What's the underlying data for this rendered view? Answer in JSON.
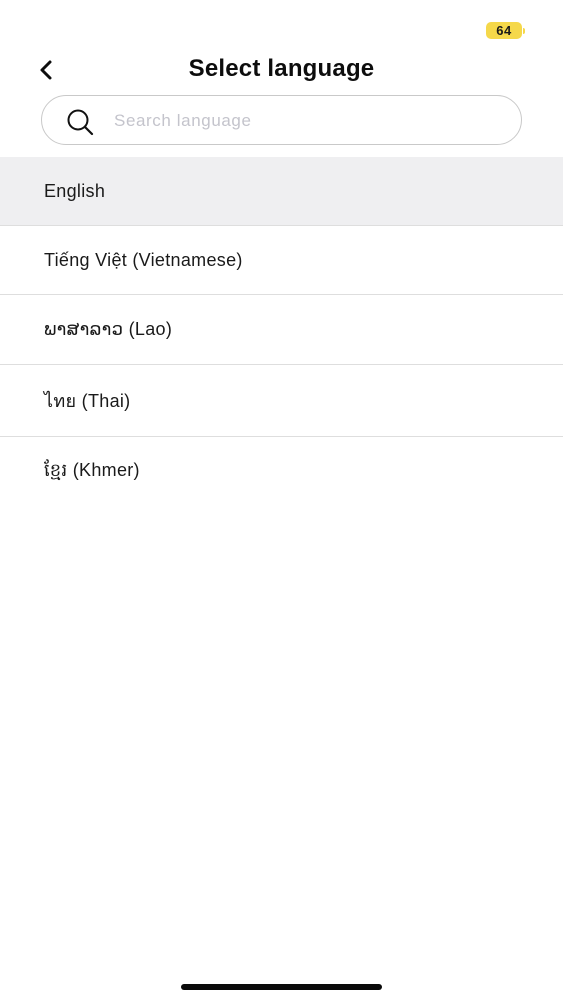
{
  "status_bar": {
    "battery_level": "64",
    "battery_color": "#f5d84a"
  },
  "header": {
    "title": "Select language",
    "back_icon": "chevron-left-icon"
  },
  "search": {
    "placeholder": "Search language",
    "value": "",
    "icon": "search-icon"
  },
  "languages": [
    {
      "label": "English",
      "selected": true
    },
    {
      "label": "Tiếng Việt (Vietnamese)",
      "selected": false
    },
    {
      "label": "ພາສາລາວ (Lao)",
      "selected": false
    },
    {
      "label": "ไทย (Thai)",
      "selected": false
    },
    {
      "label": "ខ្មែរ (Khmer)",
      "selected": false
    }
  ],
  "colors": {
    "selected_row": "#efeff1",
    "divider": "#dedede",
    "text": "#1a1a1a"
  }
}
